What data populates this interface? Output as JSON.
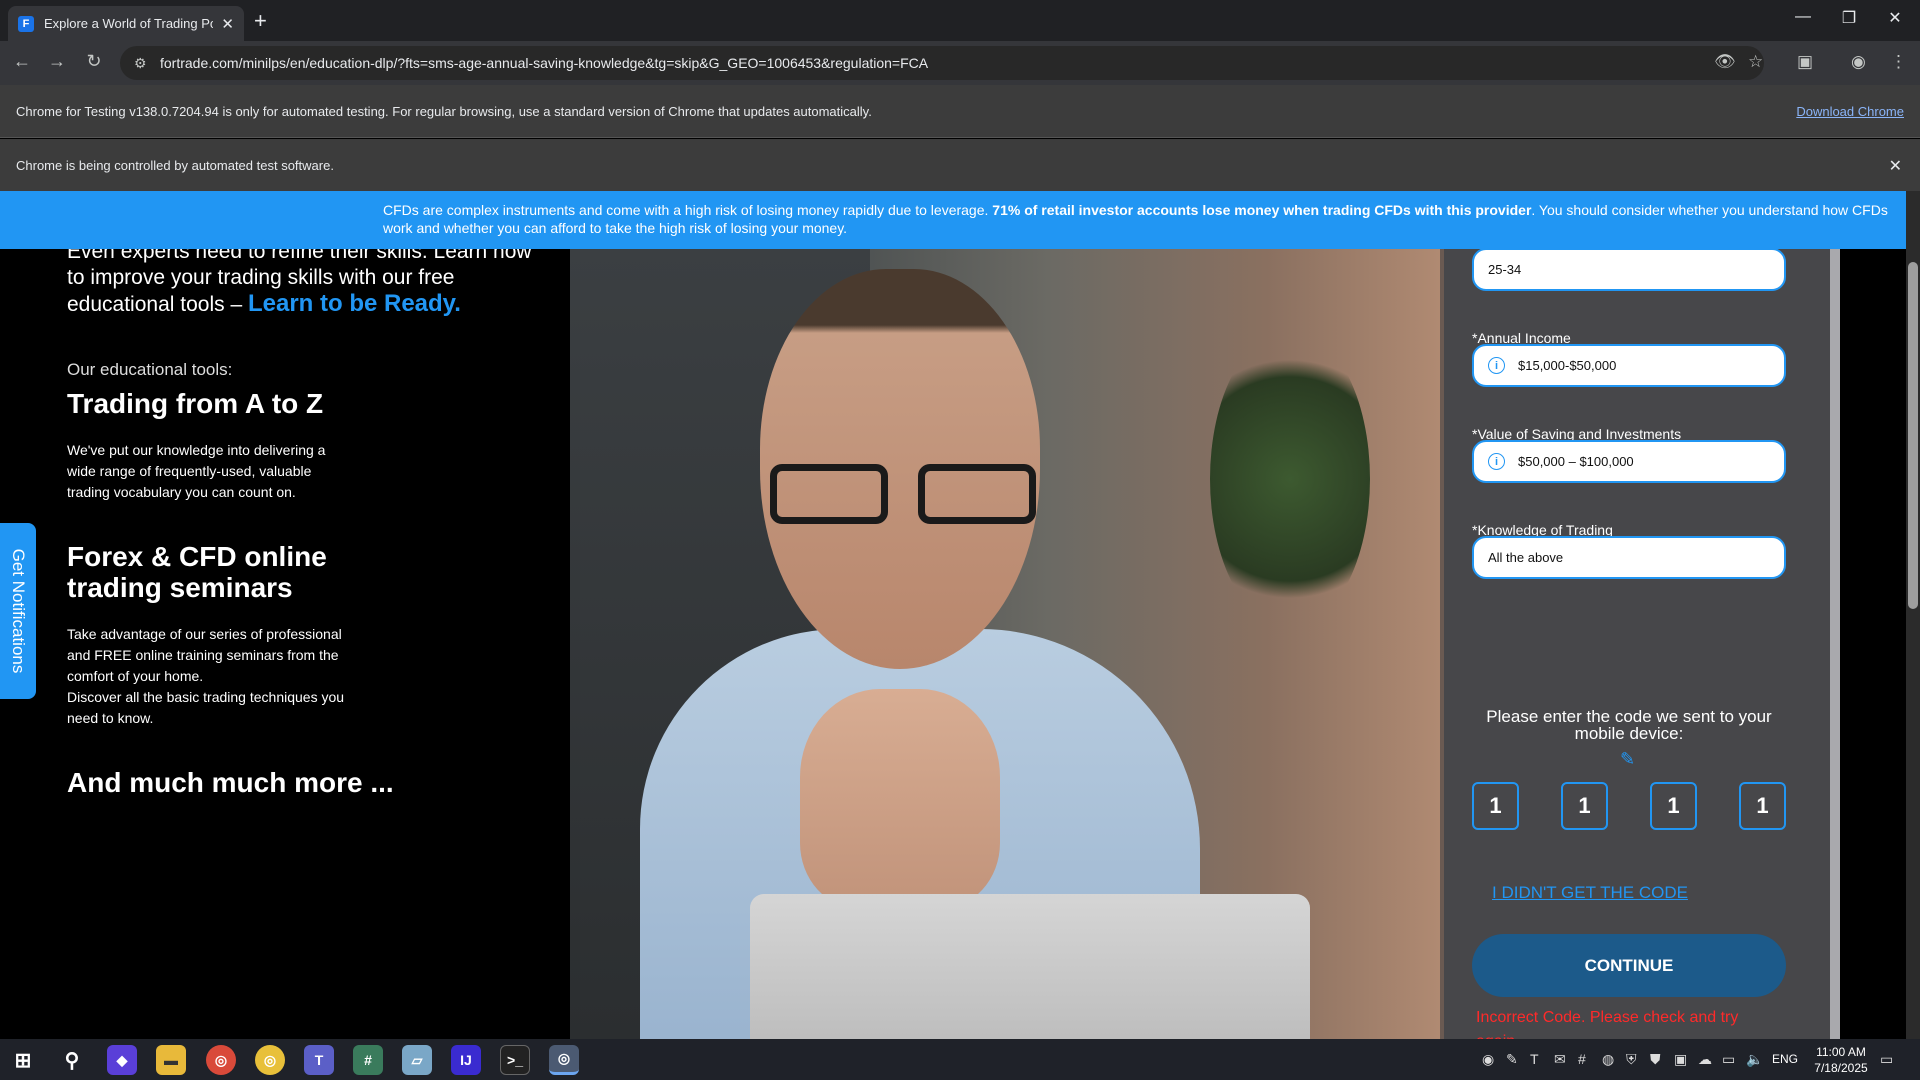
{
  "browser": {
    "tab_title": "Explore a World of Trading Possibilities",
    "tab_favicon": "F",
    "url": "fortrade.com/minilps/en/education-dlp/?fts=sms-age-annual-saving-knowledge&tg=skip&G_GEO=1006453&regulation=FCA",
    "infobar_testing": "Chrome for Testing v138.0.7204.94 is only for automated testing. For regular browsing, use a standard version of Chrome that updates automatically.",
    "download_chrome": "Download Chrome",
    "infobar_automation": "Chrome is being controlled by automated test software."
  },
  "risk_banner": {
    "part1": "CFDs are complex instruments and come with a high risk of losing money rapidly due to leverage. ",
    "bold": "71% of retail investor accounts lose money when trading CFDs with this provider",
    "part2": ". You should consider whether you understand how CFDs work and whether you can afford to take the high risk of losing your money."
  },
  "notifications_tab": "Get Notifications",
  "left": {
    "intro": "Even experts need to refine their skills. Learn how to improve your trading skills with our free educational tools – ",
    "intro_accent": "Learn to be Ready.",
    "tools_label": "Our educational tools:",
    "section1_title": "Trading from A to Z",
    "section1_text": "We've put our knowledge into delivering a wide range of frequently-used, valuable trading vocabulary you can count on.",
    "section2_title": "Forex & CFD online trading seminars",
    "section2_text1": "Take advantage of our series of professional and FREE online training seminars from the comfort of your home.",
    "section2_text2": "Discover all the basic trading techniques you need to know.",
    "section3_title": "And much much more ..."
  },
  "form": {
    "age_value": "25-34",
    "income_label": "*Annual Income",
    "income_value": "$15,000-$50,000",
    "savings_label": "*Value of Saving and Investments",
    "savings_value": "$50,000 – $100,000",
    "knowledge_label": "*Knowledge of Trading",
    "knowledge_value": "All the above",
    "code_prompt": "Please enter the code we sent to your mobile device:",
    "code_digits": [
      "1",
      "1",
      "1",
      "1"
    ],
    "resend_link": "I DIDN'T GET THE CODE",
    "continue_button": "CONTINUE",
    "error_text": "Incorrect Code. Please check and try again."
  },
  "taskbar": {
    "language": "ENG",
    "time": "11:00 AM",
    "date": "7/18/2025"
  },
  "colors": {
    "accent": "#2196f3",
    "error": "#ff2a2a",
    "button": "#1c5a8a"
  }
}
